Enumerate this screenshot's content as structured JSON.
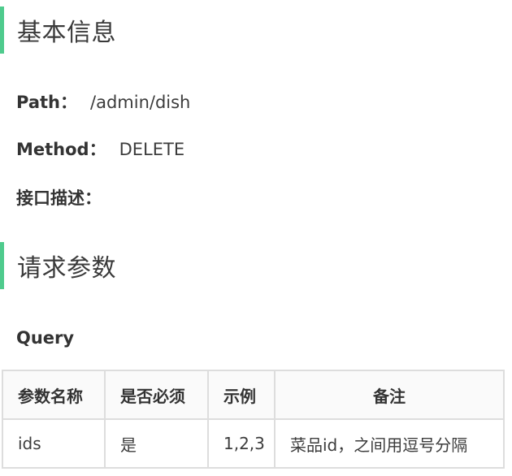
{
  "sections": {
    "basic_info_title": "基本信息",
    "request_params_title": "请求参数"
  },
  "basic_info": {
    "path_label": "Path：",
    "path_value": "/admin/dish",
    "method_label": "Method：",
    "method_value": "DELETE",
    "desc_label": "接口描述："
  },
  "query": {
    "label": "Query",
    "headers": [
      "参数名称",
      "是否必须",
      "示例",
      "备注"
    ],
    "rows": [
      [
        "ids",
        "是",
        "1,2,3",
        "菜品id，之间用逗号分隔"
      ]
    ]
  },
  "colors": {
    "accent_bar": "#4fcb8d",
    "table_border": "#dddddd"
  }
}
